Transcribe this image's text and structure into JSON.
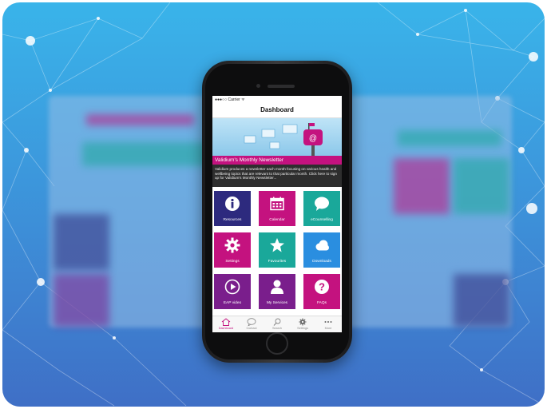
{
  "colors": {
    "magenta": "#c4127f",
    "purple": "#7a1e8c",
    "navy": "#2d2a7e",
    "teal": "#1aa89a",
    "blue": "#2a8ee0",
    "background_top": "#39b4ea",
    "background_bottom": "#3f6fc6"
  },
  "status_bar": {
    "carrier": "●●●○○ Carrier ᯤ"
  },
  "nav": {
    "title": "Dashboard"
  },
  "newsletter": {
    "title": "Validium's Monthly Newsletter",
    "description": "Validium produces a newsletter each month focusing on various health and wellbeing topics that are relevant to that particular month. Click here to sign up for Validium's Monthly Newsletter...",
    "icons": [
      "envelope-icon",
      "mailbox-icon",
      "at-sign-icon"
    ]
  },
  "tiles": [
    {
      "label": "Resources",
      "icon": "info-icon",
      "color": "navy"
    },
    {
      "label": "Calendar",
      "icon": "calendar-icon",
      "color": "magenta"
    },
    {
      "label": "eCounselling",
      "icon": "chat-bubble-icon",
      "color": "teal"
    },
    {
      "label": "Settings",
      "icon": "gear-icon",
      "color": "magenta"
    },
    {
      "label": "Favourites",
      "icon": "star-icon",
      "color": "teal"
    },
    {
      "label": "Downloads",
      "icon": "cloud-icon",
      "color": "blue"
    },
    {
      "label": "EAP video",
      "icon": "play-icon",
      "color": "purple"
    },
    {
      "label": "My Services",
      "icon": "person-icon",
      "color": "purple"
    },
    {
      "label": "FAQs",
      "icon": "question-icon",
      "color": "magenta"
    }
  ],
  "tabbar": [
    {
      "label": "Dashboard",
      "icon": "home-icon",
      "active": true
    },
    {
      "label": "Contact",
      "icon": "speech-bubble-icon",
      "active": false
    },
    {
      "label": "Search",
      "icon": "search-icon",
      "active": false
    },
    {
      "label": "Settings",
      "icon": "gear-icon",
      "active": false
    },
    {
      "label": "More",
      "icon": "more-icon",
      "active": false
    }
  ]
}
